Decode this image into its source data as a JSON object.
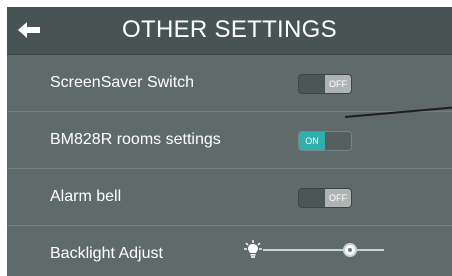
{
  "header": {
    "title": "OTHER SETTINGS",
    "back_icon": "back-arrow-icon"
  },
  "settings": [
    {
      "label": "ScreenSaver Switch",
      "control": "toggle",
      "state": "OFF"
    },
    {
      "label": "BM828R rooms settings",
      "control": "toggle",
      "state": "ON"
    },
    {
      "label": "Alarm bell",
      "control": "toggle",
      "state": "OFF"
    },
    {
      "label": "Backlight Adjust",
      "control": "slider",
      "value_fraction": 0.72,
      "icon": "bulb-icon"
    }
  ],
  "colors": {
    "panel": "#5f6b6a",
    "header": "#485453",
    "on_accent": "#30b0ad",
    "off_knob": "#aeb4b3",
    "divider": "#76817f",
    "annotation_line": "#1e1e1e"
  }
}
